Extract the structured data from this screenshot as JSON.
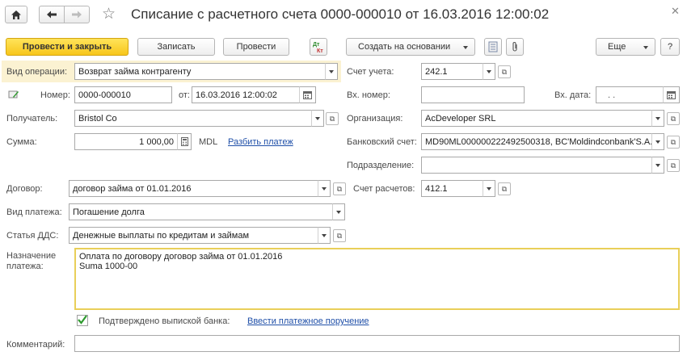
{
  "window": {
    "title": "Списание с расчетного счета 0000-000010 от 16.03.2016 12:00:02",
    "icons": [
      "home-icon",
      "back-arrow-icon",
      "forward-arrow-icon",
      "star-icon",
      "close-icon"
    ]
  },
  "toolbar": {
    "post_close_label": "Провести и закрыть",
    "write_label": "Записать",
    "post_label": "Провести",
    "create_based_label": "Создать на основании",
    "more_label": "Еще",
    "help_label": "?"
  },
  "form": {
    "operation": {
      "label": "Вид операции:",
      "value": "Возврат займа контрагенту"
    },
    "number": {
      "label": "Номер:",
      "value": "0000-000010"
    },
    "date": {
      "label": "от:",
      "value": "16.03.2016 12:00:02"
    },
    "recipient": {
      "label": "Получатель:",
      "value": "Bristol Co"
    },
    "amount": {
      "label": "Сумма:",
      "value": "1 000,00",
      "currency": "MDL",
      "split_link": "Разбить платеж"
    },
    "contract": {
      "label": "Договор:",
      "value": "договор займа от 01.01.2016"
    },
    "payment_type": {
      "label": "Вид платежа:",
      "value": "Погашение долга"
    },
    "dds_article": {
      "label": "Статья ДДС:",
      "value": "Денежные выплаты по кредитам и займам"
    },
    "purpose": {
      "label_line1": "Назначение",
      "label_line2": "платежа:",
      "value": "Оплата по договору договор займа от 01.01.2016\nSuma 1000-00"
    },
    "bank_confirmed": {
      "label": "Подтверждено выпиской банка:",
      "checked": true,
      "link": "Ввести платежное поручение"
    },
    "comment": {
      "label": "Комментарий:",
      "value": ""
    },
    "account": {
      "label": "Счет учета:",
      "value": "242.1"
    },
    "incoming_number": {
      "label": "Вх. номер:",
      "value": ""
    },
    "incoming_date": {
      "label": "Вх. дата:",
      "value": ". ."
    },
    "organization": {
      "label": "Организация:",
      "value": "AcDeveloper SRL"
    },
    "bank_account": {
      "label": "Банковский счет:",
      "value": "MD90ML000000222492500318, BC'Moldindconbank'S.A."
    },
    "subdivision": {
      "label": "Подразделение:",
      "value": ""
    },
    "settlement_account": {
      "label": "Счет расчетов:",
      "value": "412.1"
    }
  },
  "colors": {
    "primary_button": "#f7c61b",
    "highlight_row": "#fbf2d2",
    "link": "#1f4fa8",
    "check": "#2e9a2e"
  }
}
